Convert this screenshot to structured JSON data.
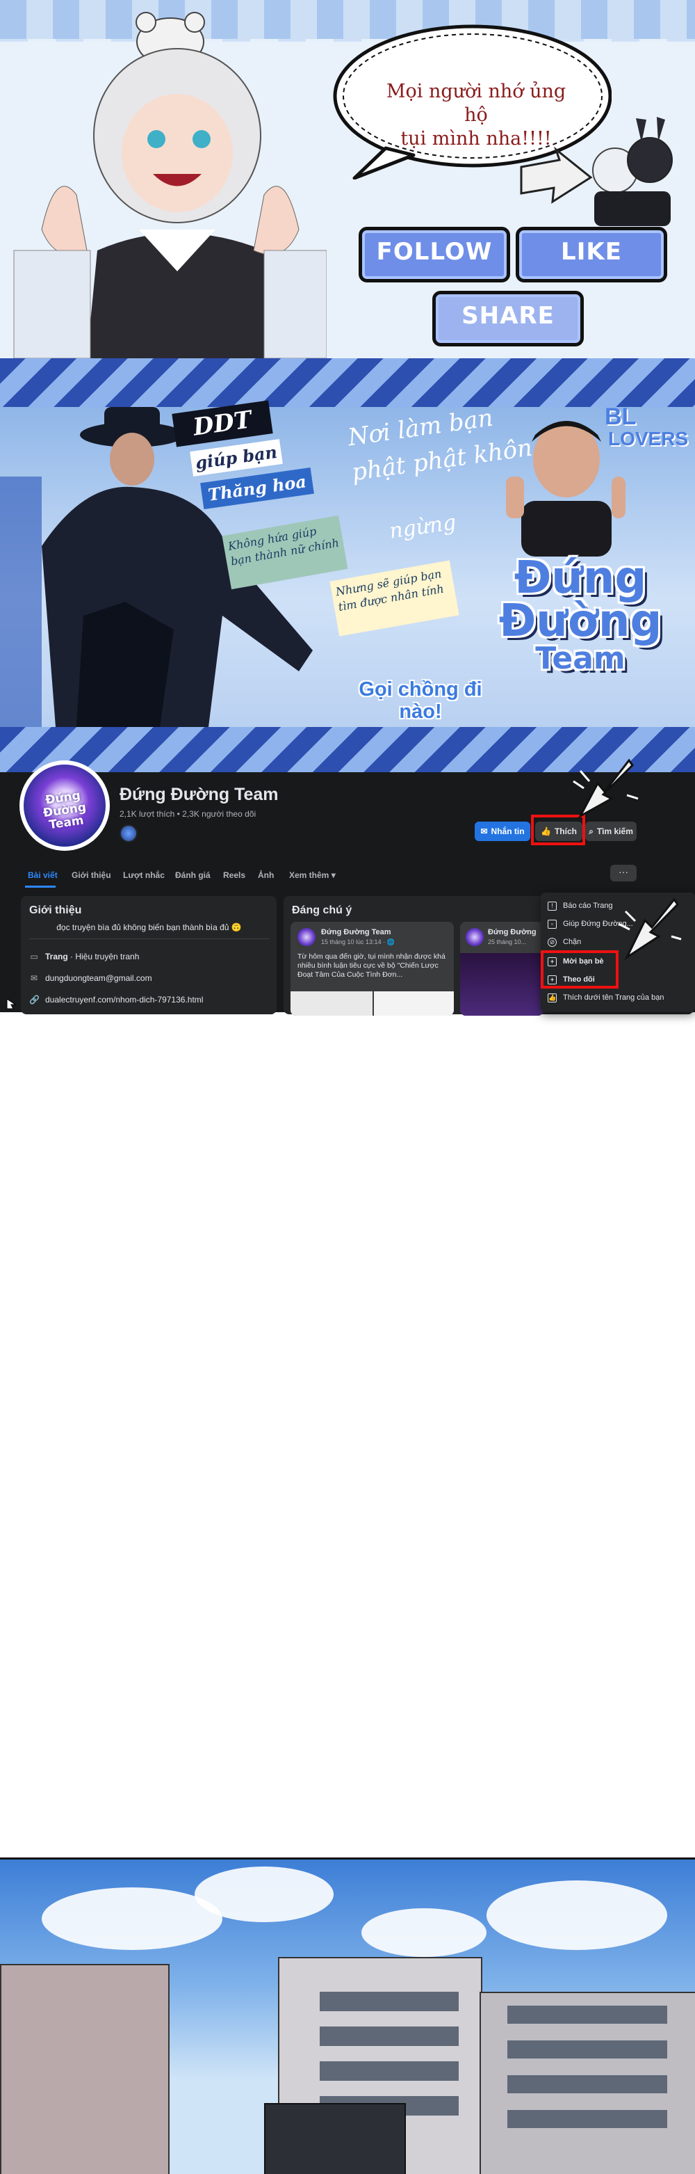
{
  "banner": {
    "bubble_line1": "Mọi người nhớ ủng hộ",
    "bubble_line2": "tụi mình nha!!!!",
    "follow_label": "FOLLOW",
    "like_label": "LIKE",
    "share_label": "SHARE"
  },
  "cover": {
    "tag1": "DDT",
    "tag2": "giúp bạn",
    "tag3": "Thăng hoa",
    "tag_bl": "BL",
    "tag_lovers": "LOVERS",
    "script1": "Nơi làm bạn",
    "script2": "phật phật không",
    "script3": "ngừng",
    "green_box": "Không hứa giúp bạn thành nữ chính",
    "yellow_box": "Nhưng sẽ giúp bạn tìm được nhân tính",
    "team_line1": "Đứng",
    "team_line2": "Đường",
    "team_line3": "Team",
    "call": "Gọi chồng đi nào!"
  },
  "fb": {
    "logo_text": "Đứng Đường Team",
    "page_name": "Đứng Đường Team",
    "stats": "2,1K lượt thích • 2,3K người theo dõi",
    "btn_message": "Nhắn tin",
    "btn_like": "Thích",
    "btn_search": "Tìm kiếm",
    "tabs": [
      "Bài viết",
      "Giới thiệu",
      "Lượt nhắc",
      "Đánh giá",
      "Reels",
      "Ảnh",
      "Xem thêm"
    ],
    "more_label": "···",
    "intro": {
      "title": "Giới thiệu",
      "bio": "đọc truyện bìa đủ không biến bạn thành bìa đủ 🙃",
      "category_bold": "Trang",
      "category": " · Hiệu truyện tranh",
      "email": "dungduongteam@gmail.com",
      "link": "dualectruyenf.com/nhom-dich-797136.html"
    },
    "featured": {
      "title": "Đáng chú ý",
      "post1_name": "Đứng Đường Team",
      "post1_date": "15 tháng 10 lúc 13:14 · 🌐",
      "post1_body": "Từ hôm qua đến giờ, tụi mình nhận được khá nhiều bình luận tiêu cực về bộ \"Chiến Lược Đoạt Tâm Của Cuộc Tình Đơn...",
      "post2_name": "Đứng Đường",
      "post2_date": "25 tháng 10..."
    },
    "menu": [
      {
        "icon": "report-icon",
        "label": "Báo cáo Trang"
      },
      {
        "icon": "page-icon",
        "label": "Giúp Đứng Đường..."
      },
      {
        "icon": "block-icon",
        "label": "Chặn"
      },
      {
        "icon": "invite-icon",
        "label": "Mời bạn bè"
      },
      {
        "icon": "follow-icon",
        "label": "Theo dõi"
      },
      {
        "icon": "like-as-page-icon",
        "label": "Thích dưới tên Trang của bạn"
      }
    ]
  },
  "colors": {
    "fb_blue": "#2374e1",
    "fb_dark": "#18191a",
    "highlight_red": "#ee1111",
    "cta_blue": "#6f8ee8"
  }
}
